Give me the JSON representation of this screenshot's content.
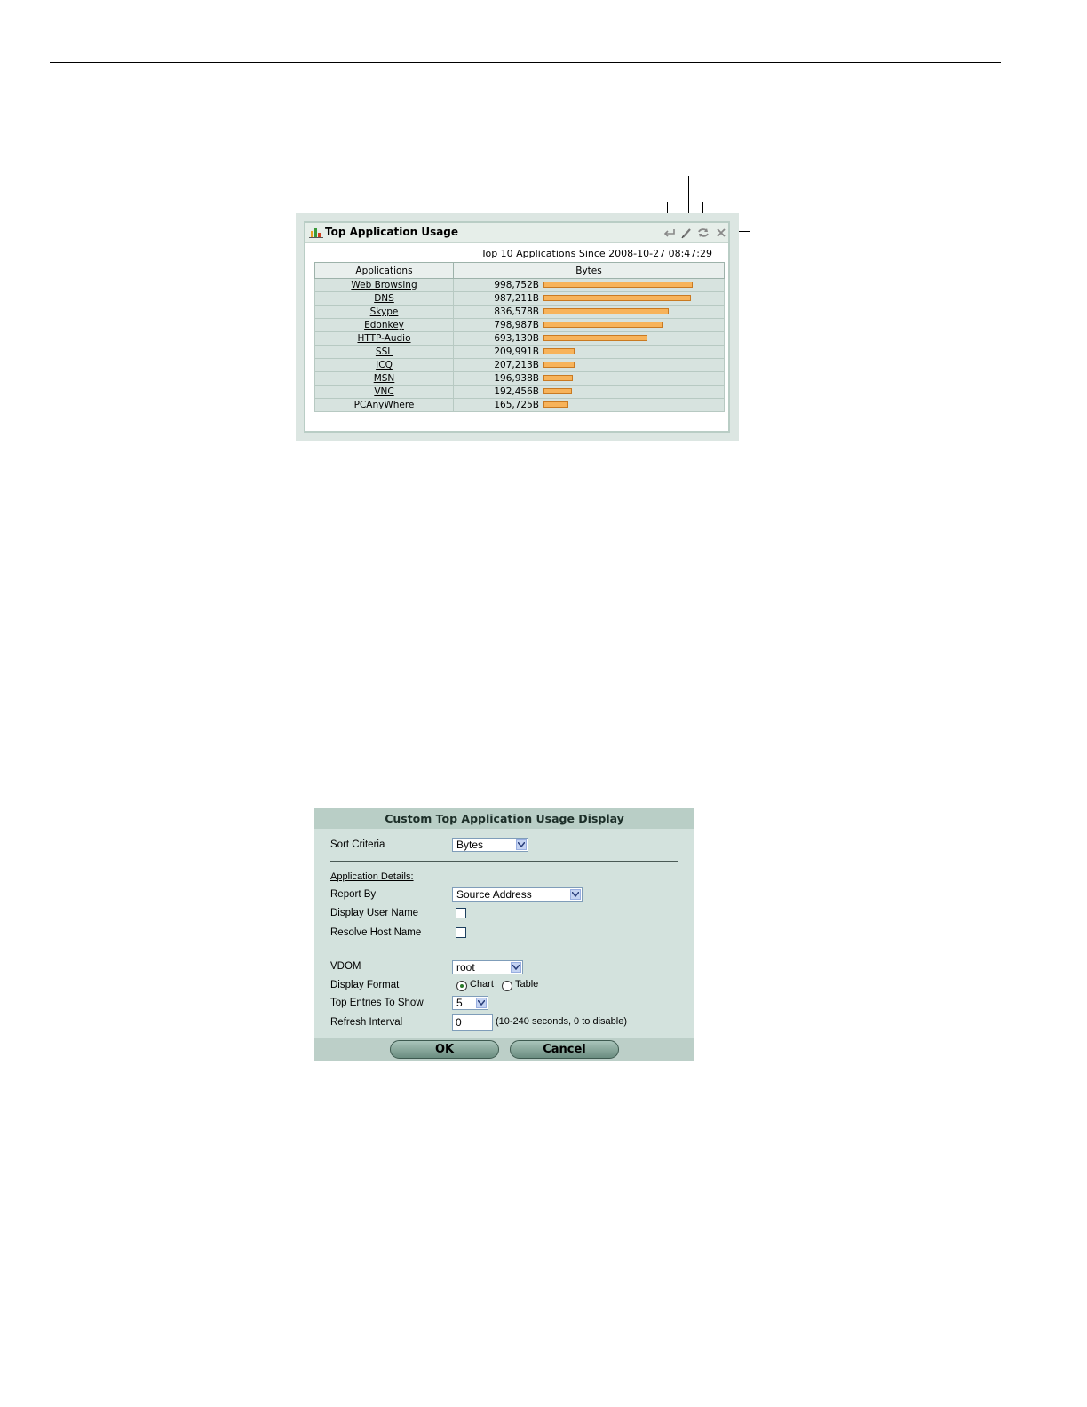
{
  "widget": {
    "title": "Top Application Usage",
    "subtitle": "Top 10 Applications Since 2008-10-27 08:47:29",
    "icons": [
      "history-icon",
      "edit-icon",
      "refresh-icon",
      "close-icon"
    ],
    "columns": [
      "Applications",
      "Bytes"
    ],
    "rows": [
      {
        "app": "Web Browsing",
        "bytes": "998,752B",
        "value": 998752
      },
      {
        "app": "DNS",
        "bytes": "987,211B",
        "value": 987211
      },
      {
        "app": "Skype",
        "bytes": "836,578B",
        "value": 836578
      },
      {
        "app": "Edonkey",
        "bytes": "798,987B",
        "value": 798987
      },
      {
        "app": "HTTP-Audio",
        "bytes": "693,130B",
        "value": 693130
      },
      {
        "app": "SSL",
        "bytes": "209,991B",
        "value": 209991
      },
      {
        "app": "ICQ",
        "bytes": "207,213B",
        "value": 207213
      },
      {
        "app": "MSN",
        "bytes": "196,938B",
        "value": 196938
      },
      {
        "app": "VNC",
        "bytes": "192,456B",
        "value": 192456
      },
      {
        "app": "PCAnyWhere",
        "bytes": "165,725B",
        "value": 165725
      }
    ],
    "bar_color": "#f7b35a"
  },
  "dialog": {
    "title": "Custom Top Application Usage Display",
    "sort_criteria_label": "Sort Criteria",
    "sort_criteria_value": "Bytes",
    "application_details_label": "Application Details:",
    "report_by_label": "Report By",
    "report_by_value": "Source Address",
    "display_user_name_label": "Display User Name",
    "display_user_name_checked": false,
    "resolve_host_name_label": "Resolve Host Name",
    "resolve_host_name_checked": false,
    "vdom_label": "VDOM",
    "vdom_value": "root",
    "display_format_label": "Display Format",
    "format_chart_label": "Chart",
    "format_table_label": "Table",
    "display_format_selected": "Chart",
    "top_entries_label": "Top Entries To Show",
    "top_entries_value": "5",
    "refresh_interval_label": "Refresh Interval",
    "refresh_interval_value": "0",
    "refresh_interval_hint": "(10-240 seconds, 0 to disable)",
    "ok_label": "OK",
    "cancel_label": "Cancel"
  }
}
